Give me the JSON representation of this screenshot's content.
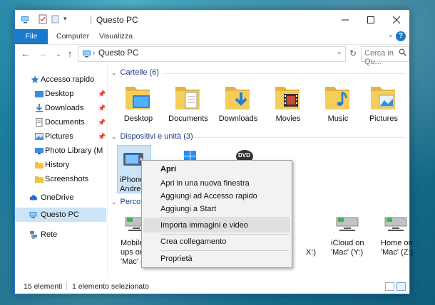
{
  "window": {
    "title": "Questo PC"
  },
  "ribbon": {
    "tabs": [
      "File",
      "Computer",
      "Visualizza"
    ]
  },
  "address": {
    "path": "Questo PC",
    "search_placeholder": "Cerca in Qu..."
  },
  "navpane": {
    "quick_access": "Accesso rapido",
    "items": [
      "Desktop",
      "Downloads",
      "Documents",
      "Pictures",
      "Photo Library (M",
      "History",
      "Screenshots"
    ],
    "onedrive": "OneDrive",
    "this_pc": "Questo PC",
    "network": "Rete"
  },
  "content": {
    "folders_header": "Cartelle (6)",
    "folders": [
      "Desktop",
      "Documents",
      "Downloads",
      "Movies",
      "Music",
      "Pictures"
    ],
    "devices_header": "Dispositivi e unità (3)",
    "device_label_line1": "iPhone",
    "device_label_line2": "Andre",
    "dvd_badge": "DVD",
    "network_header": "Percors",
    "net_left_line1": "Mobile",
    "net_left_line2": "ups on",
    "net_left_line3": "'Mac' (",
    "net_partial": "X:)",
    "net_icloud_line1": "iCloud on",
    "net_icloud_line2": "'Mac' (Y:)",
    "net_home_line1": "Home on",
    "net_home_line2": "'Mac' (Z:)"
  },
  "context_menu": {
    "items": [
      "Apri",
      "Apri in una nuova finestra",
      "Aggiungi ad Accesso rapido",
      "Aggiungi a Start",
      "Importa immagini e video",
      "Crea collegamento",
      "Proprietà"
    ]
  },
  "status": {
    "count": "15 elementi",
    "selected": "1 elemento selezionato"
  }
}
